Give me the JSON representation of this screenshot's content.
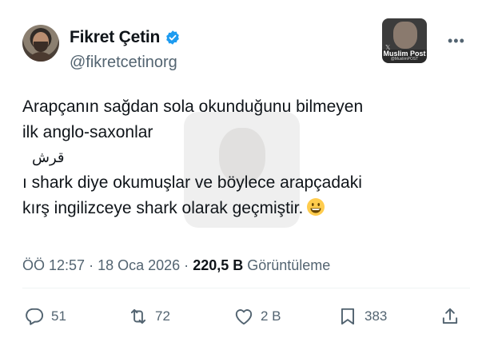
{
  "tweet": {
    "display_name": "Fikret Çetin",
    "handle": "@fikretcetinorg",
    "verified": true,
    "more_label": "•••",
    "brand_badge": {
      "title": "Muslim Post",
      "subtitle": "@MuslimPOST",
      "x_mark": "𝕏"
    },
    "body": {
      "line1": "Arapçanın sağdan sola okunduğunu bilmeyen",
      "line2": "ilk anglo-saxonlar",
      "arabic": "قرش",
      "line3": "ı shark diye okumuşlar ve böylece arapçadaki",
      "line4": "kırş ingilizceye shark olarak geçmiştir."
    },
    "watermark_text": "@MuslimPOST",
    "time": "ÖÖ 12:57",
    "date": "18 Oca 2026",
    "separator": "·",
    "views_count": "220,5 B",
    "views_label": "Görüntüleme"
  },
  "actions": {
    "reply": {
      "icon": "reply-icon",
      "count": "51"
    },
    "retweet": {
      "icon": "retweet-icon",
      "count": "72"
    },
    "like": {
      "icon": "heart-icon",
      "count": "2 B"
    },
    "bookmark": {
      "icon": "bookmark-icon",
      "count": "383"
    },
    "share": {
      "icon": "share-icon"
    }
  },
  "colors": {
    "text_primary": "#0f1419",
    "text_secondary": "#536471",
    "verified_blue": "#1d9bf0",
    "divider": "#eff3f4"
  }
}
